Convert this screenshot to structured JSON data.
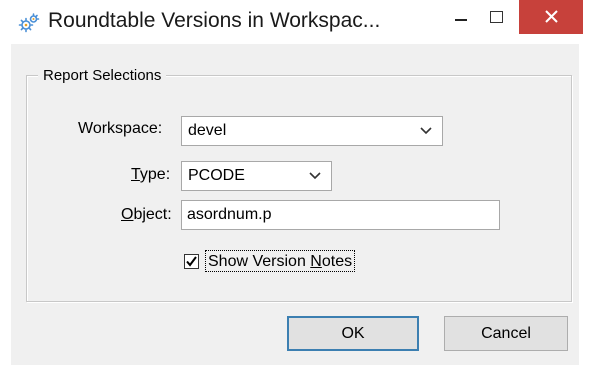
{
  "window": {
    "title": "Roundtable Versions in Workspac...",
    "icon": "roundtable-gears-icon",
    "controls": {
      "minimize": "minimize-icon",
      "maximize": "maximize-icon",
      "close": "close-icon"
    },
    "close_color": "#c7413b"
  },
  "group": {
    "legend": "Report Selections"
  },
  "workspace": {
    "label": "Workspace:",
    "value": "devel"
  },
  "type": {
    "label_mnemonic": "T",
    "label_rest": "ype:",
    "value": "PCODE"
  },
  "object": {
    "label_mnemonic": "O",
    "label_rest": "bject:",
    "value": "asordnum.p"
  },
  "show_notes": {
    "checked": true,
    "label_pre": "Show Version ",
    "label_mnemonic": "N",
    "label_post": "otes"
  },
  "buttons": {
    "ok": "OK",
    "cancel": "Cancel"
  }
}
